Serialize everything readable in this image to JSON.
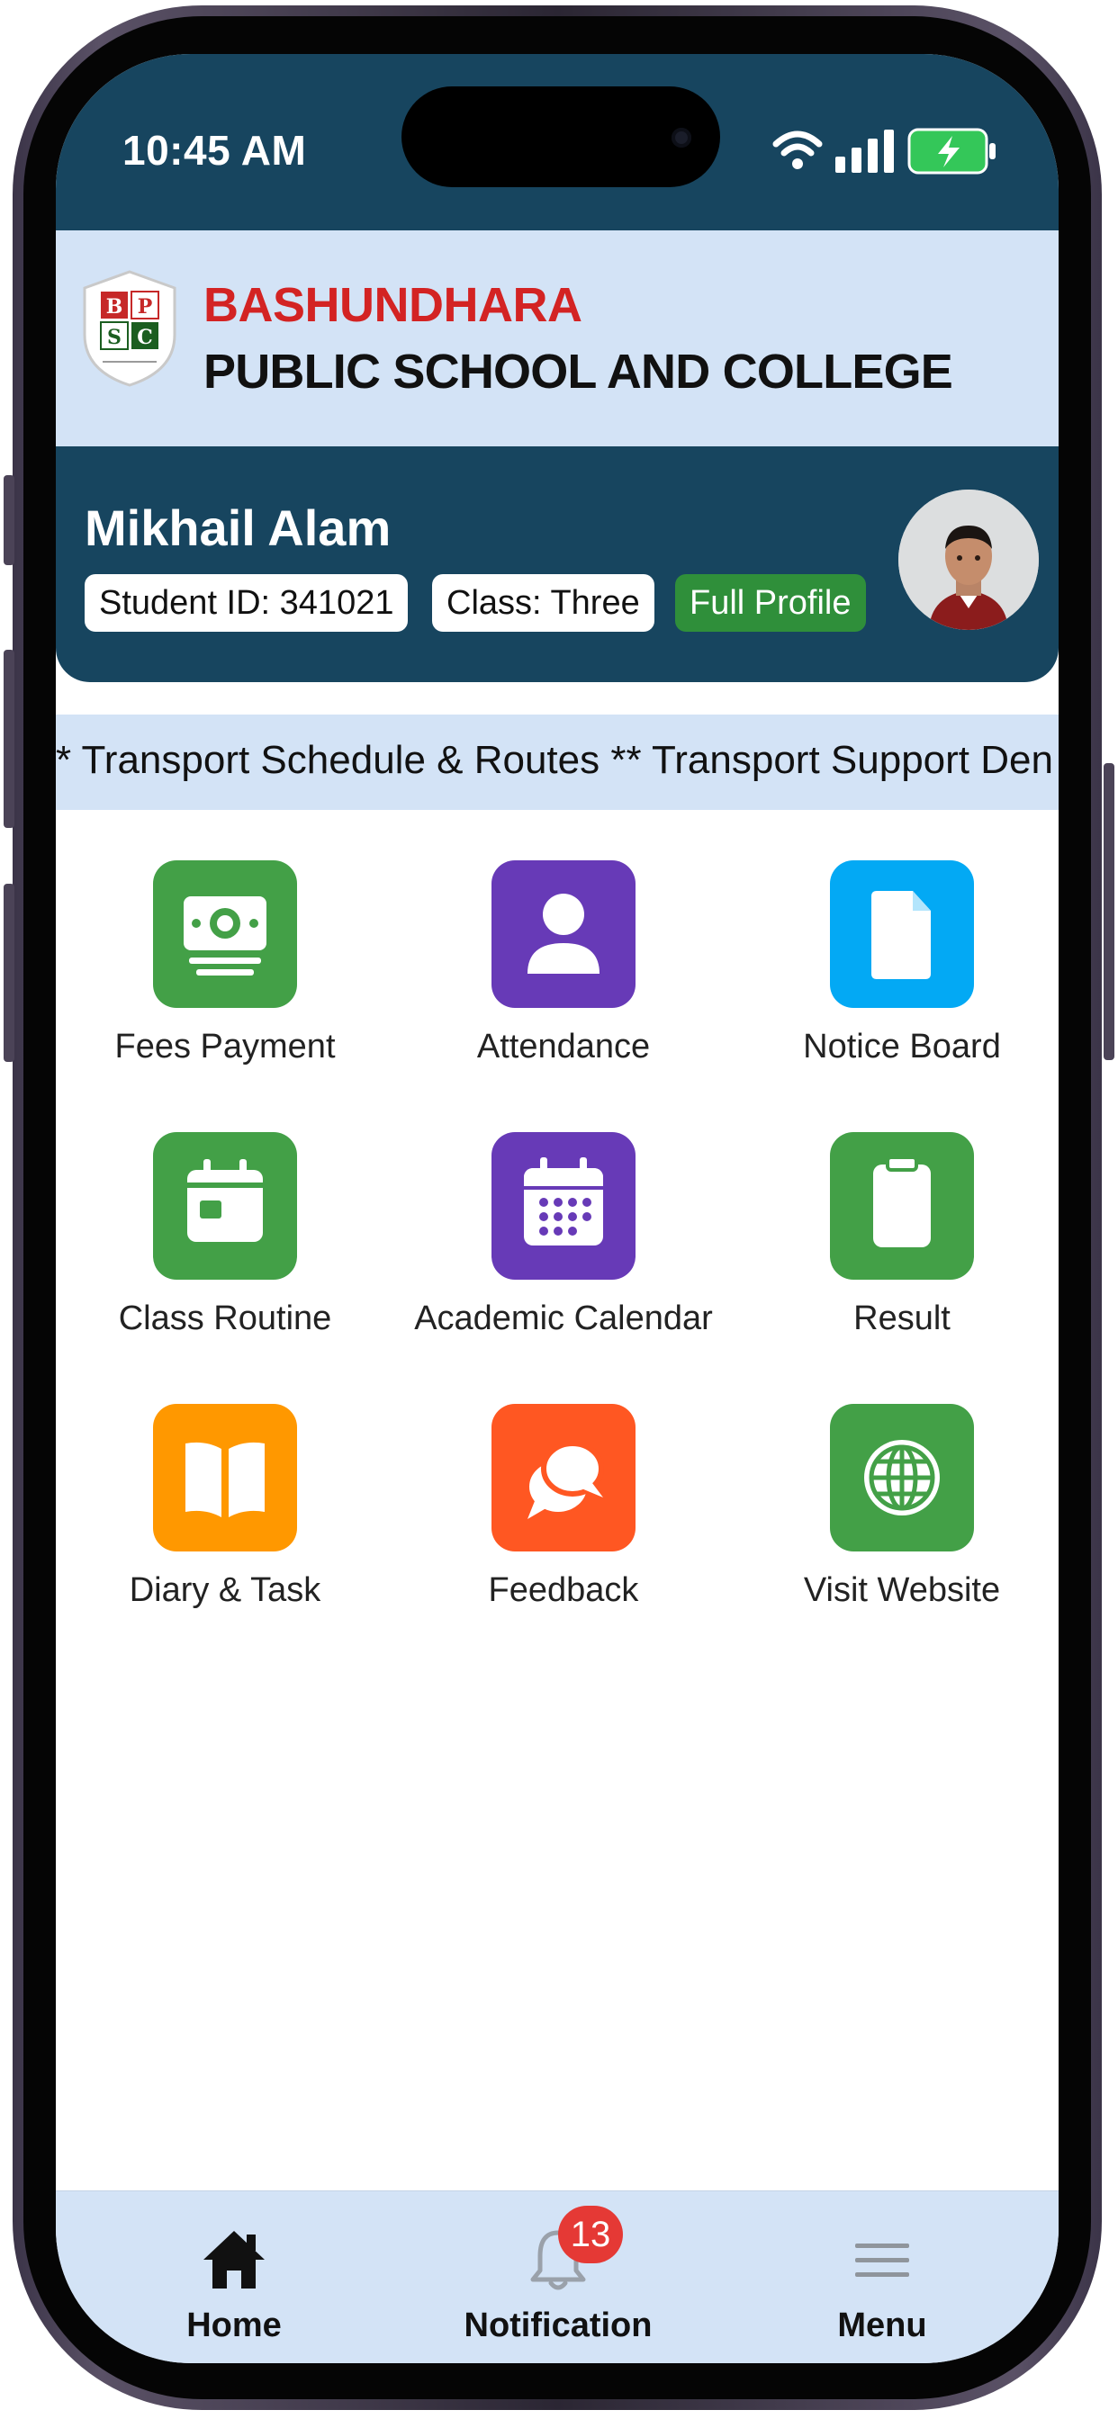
{
  "status_bar": {
    "time": "10:45 AM",
    "icons": [
      "wifi-icon",
      "cellular-signal-icon",
      "battery-charging-icon"
    ]
  },
  "header": {
    "logo_letters": [
      "B",
      "P",
      "S",
      "C"
    ],
    "school_name_line1": "BASHUNDHARA",
    "school_name_line2": "PUBLIC SCHOOL AND COLLEGE"
  },
  "profile": {
    "name": "Mikhail Alam",
    "student_id": "Student ID: 341021",
    "class": "Class: Three",
    "full_profile_label": "Full Profile"
  },
  "ticker": {
    "text": "* Transport Schedule & Routes ** Transport Support Den"
  },
  "grid": {
    "items": [
      {
        "label": "Fees Payment",
        "icon": "cash-icon",
        "color": "#43a047"
      },
      {
        "label": "Attendance",
        "icon": "person-icon",
        "color": "#673ab7"
      },
      {
        "label": "Notice Board",
        "icon": "document-icon",
        "color": "#03a9f4"
      },
      {
        "label": "Class Routine",
        "icon": "calendar-card-icon",
        "color": "#43a047"
      },
      {
        "label": "Academic Calendar",
        "icon": "calendar-grid-icon",
        "color": "#673ab7"
      },
      {
        "label": "Result",
        "icon": "clipboard-icon",
        "color": "#43a047"
      },
      {
        "label": "Diary & Task",
        "icon": "book-icon",
        "color": "#ff9800"
      },
      {
        "label": "Feedback",
        "icon": "chat-bubbles-icon",
        "color": "#ff5722"
      },
      {
        "label": "Visit Website",
        "icon": "globe-icon",
        "color": "#43a047"
      }
    ]
  },
  "bottom_nav": {
    "items": [
      {
        "label": "Home",
        "icon": "home-icon"
      },
      {
        "label": "Notification",
        "icon": "bell-icon",
        "badge": "13"
      },
      {
        "label": "Menu",
        "icon": "hamburger-menu-icon"
      }
    ]
  },
  "colors": {
    "primary_dark": "#17455f",
    "header_bg": "#d3e3f6",
    "school_red": "#d32323",
    "badge_red": "#e53935",
    "profile_green": "#2f8f3a"
  }
}
